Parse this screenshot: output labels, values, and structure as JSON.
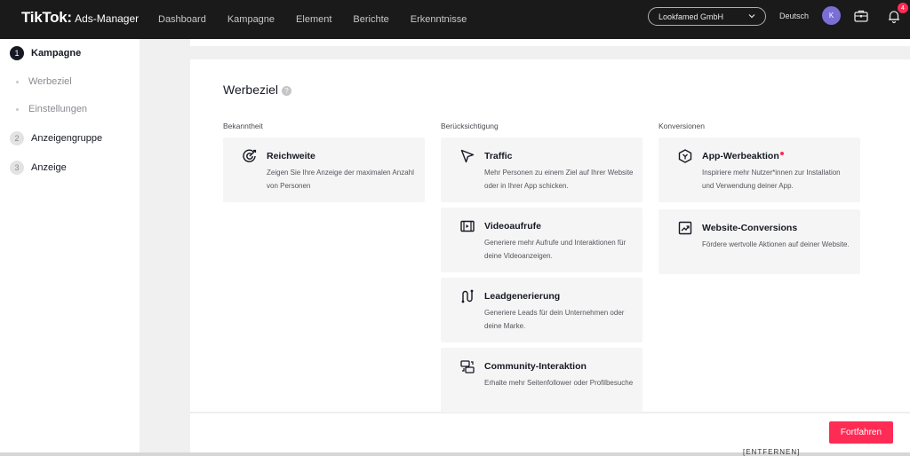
{
  "header": {
    "brand": "TikTok",
    "sub_brand": "Ads-Manager",
    "nav": [
      "Dashboard",
      "Kampagne",
      "Element",
      "Berichte",
      "Erkenntnisse"
    ],
    "account": "Lookfamed GmbH",
    "language": "Deutsch",
    "avatar_initial": "K",
    "notification_count": "4"
  },
  "sidebar": {
    "steps": [
      {
        "num": "1",
        "label": "Kampagne"
      },
      {
        "num": "2",
        "label": "Anzeigengruppe"
      },
      {
        "num": "3",
        "label": "Anzeige"
      }
    ],
    "substeps": [
      "Werbeziel",
      "Einstellungen"
    ]
  },
  "main": {
    "title": "Werbeziel",
    "help": "?",
    "columns": [
      {
        "heading": "Bekanntheit",
        "cards": [
          {
            "icon": "reach-icon",
            "title": "Reichweite",
            "desc": "Zeigen Sie Ihre Anzeige der maximalen Anzahl von Personen"
          }
        ]
      },
      {
        "heading": "Berücksichtigung",
        "cards": [
          {
            "icon": "cursor-icon",
            "title": "Traffic",
            "desc": "Mehr Personen zu einem Ziel auf Ihrer Website oder in Ihrer App schicken."
          },
          {
            "icon": "video-icon",
            "title": "Videoaufrufe",
            "desc": "Generiere mehr Aufrufe und Interaktionen für deine Videoanzeigen."
          },
          {
            "icon": "lead-icon",
            "title": "Leadgenerierung",
            "desc": "Generiere Leads für dein Unternehmen oder deine Marke."
          },
          {
            "icon": "community-icon",
            "title": "Community-Interaktion",
            "desc": "Erhalte mehr Seitenfollower oder Profilbesuche"
          }
        ]
      },
      {
        "heading": "Konversionen",
        "cards": [
          {
            "icon": "app-icon",
            "title": "App-Werbeaktion",
            "desc": "Inspiriere mehr Nutzer*innen zur Installation und Verwendung deiner App."
          },
          {
            "icon": "chart-up-icon",
            "title": "Website-Conversions",
            "desc": "Fördere wertvolle Aktionen auf deiner Website."
          }
        ]
      }
    ]
  },
  "footer": {
    "continue_label": "Fortfahren",
    "cut_text": "[ENTFERNEN]"
  },
  "colors": {
    "accent": "#fe2c55",
    "topbar": "#1a1a1a",
    "avatar": "#7b6fd6"
  }
}
